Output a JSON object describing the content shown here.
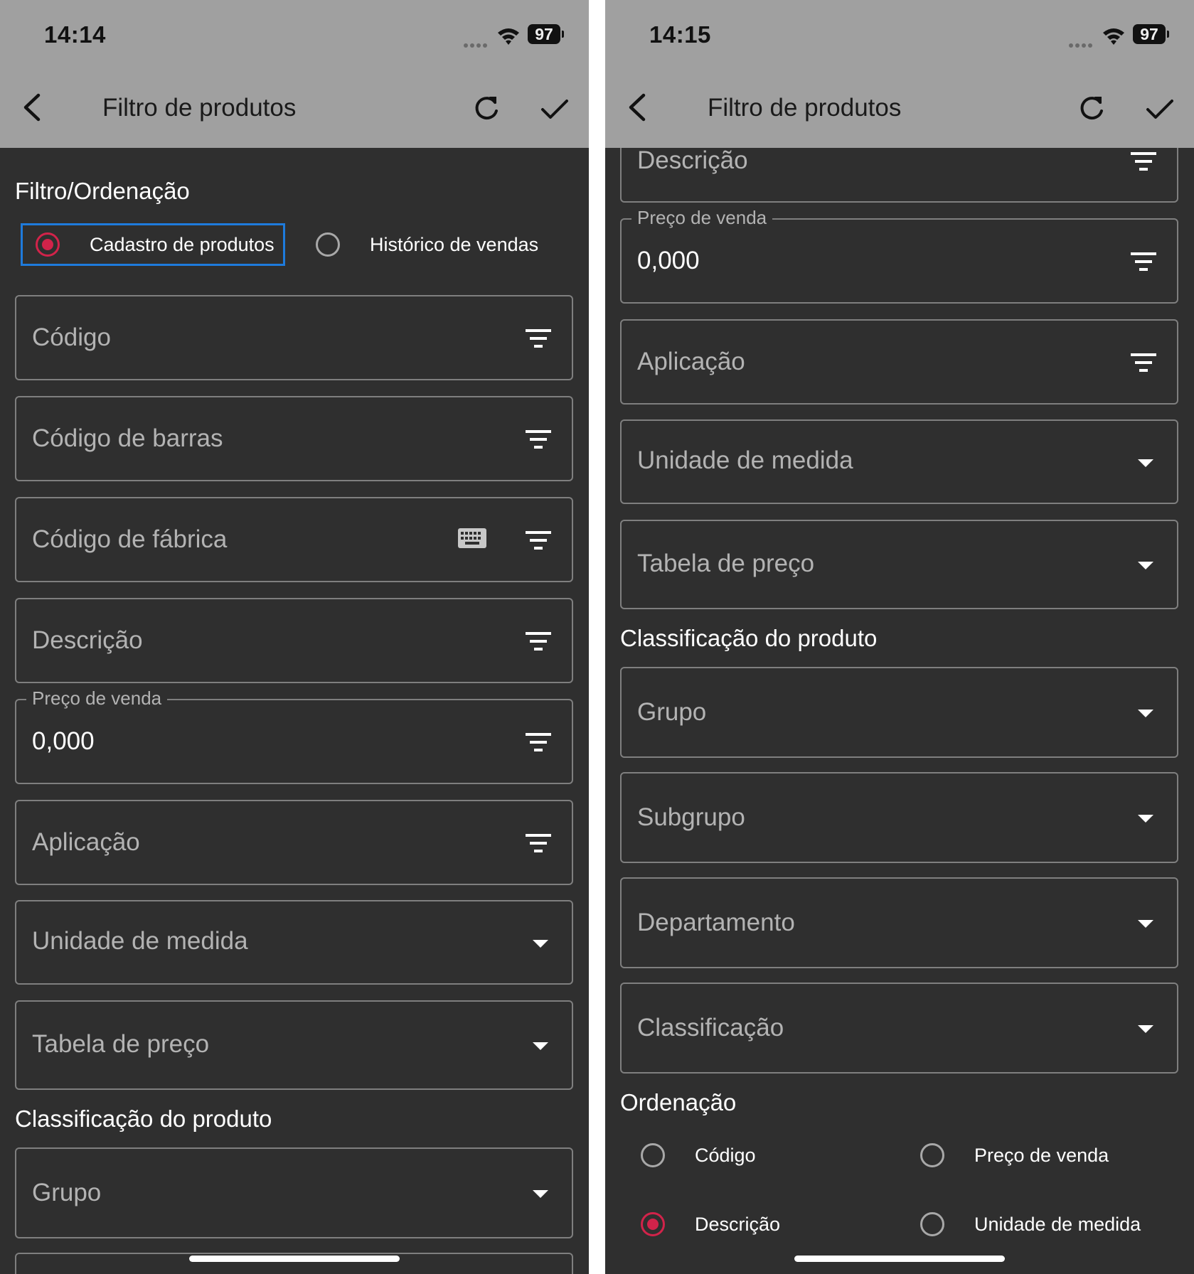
{
  "left": {
    "status": {
      "time": "14:14",
      "battery": "97"
    },
    "header": {
      "title": "Filtro de produtos"
    },
    "section_filter": "Filtro/Ordenação",
    "mode_options": [
      {
        "label": "Cadastro de produtos",
        "selected": true
      },
      {
        "label": "Histórico de vendas",
        "selected": false
      }
    ],
    "fields": {
      "codigo": "Código",
      "codigo_barras": "Código de barras",
      "codigo_fabrica": "Código de fábrica",
      "descricao": "Descrição",
      "preco_label": "Preço de venda",
      "preco_value": "0,000",
      "aplicacao": "Aplicação",
      "unidade": "Unidade de medida",
      "tabela": "Tabela de preço",
      "grupo": "Grupo"
    },
    "section_classificacao": "Classificação do produto"
  },
  "right": {
    "status": {
      "time": "14:15",
      "battery": "97"
    },
    "header": {
      "title": "Filtro de produtos"
    },
    "fields": {
      "descricao": "Descrição",
      "preco_label": "Preço de venda",
      "preco_value": "0,000",
      "aplicacao": "Aplicação",
      "unidade": "Unidade de medida",
      "tabela": "Tabela de preço",
      "grupo": "Grupo",
      "subgrupo": "Subgrupo",
      "departamento": "Departamento",
      "classificacao": "Classificação"
    },
    "section_classificacao": "Classificação do produto",
    "section_ordenacao": "Ordenação",
    "sort_options": [
      {
        "label": "Código",
        "selected": false
      },
      {
        "label": "Preço de venda",
        "selected": false
      },
      {
        "label": "Descrição",
        "selected": true
      },
      {
        "label": "Unidade de medida",
        "selected": false
      }
    ]
  },
  "colors": {
    "radio_selected": "#d2234a",
    "focus": "#1e7bdc",
    "background": "#2f2f2f",
    "appbar": "#a0a0a0"
  }
}
